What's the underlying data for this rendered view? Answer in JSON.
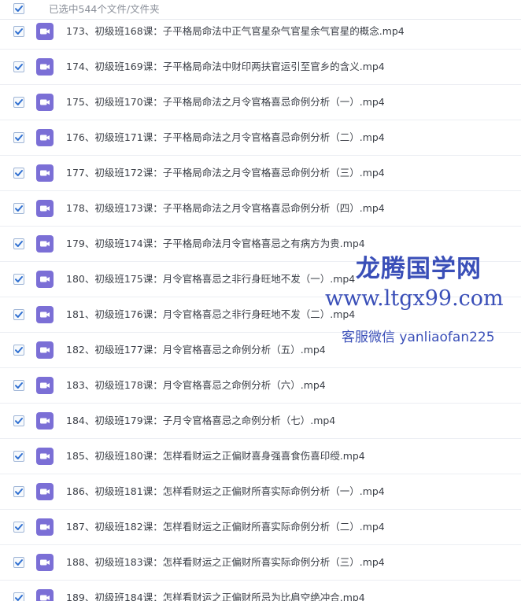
{
  "header": {
    "selected_text": "已选中544个文件/文件夹",
    "checked": true
  },
  "files": [
    {
      "name": "173、初级班168课：子平格局命法中正气官星杂气官星余气官星的概念.mp4",
      "checked": true,
      "icon": "video-file-icon"
    },
    {
      "name": "174、初级班169课：子平格局命法中财印两扶官运引至官乡的含义.mp4",
      "checked": true,
      "icon": "video-file-icon"
    },
    {
      "name": "175、初级班170课：子平格局命法之月令官格喜忌命例分析（一）.mp4",
      "checked": true,
      "icon": "video-file-icon"
    },
    {
      "name": "176、初级班171课：子平格局命法之月令官格喜忌命例分析（二）.mp4",
      "checked": true,
      "icon": "video-file-icon"
    },
    {
      "name": "177、初级班172课：子平格局命法之月令官格喜忌命例分析（三）.mp4",
      "checked": true,
      "icon": "video-file-icon"
    },
    {
      "name": "178、初级班173课：子平格局命法之月令官格喜忌命例分析（四）.mp4",
      "checked": true,
      "icon": "video-file-icon"
    },
    {
      "name": "179、初级班174课：子平格局命法月令官格喜忌之有病方为贵.mp4",
      "checked": true,
      "icon": "video-file-icon"
    },
    {
      "name": "180、初级班175课：月令官格喜忌之非行身旺地不发（一）.mp4",
      "checked": true,
      "icon": "video-file-icon"
    },
    {
      "name": "181、初级班176课：月令官格喜忌之非行身旺地不发（二）.mp4",
      "checked": true,
      "icon": "video-file-icon"
    },
    {
      "name": "182、初级班177课：月令官格喜忌之命例分析（五）.mp4",
      "checked": true,
      "icon": "video-file-icon"
    },
    {
      "name": "183、初级班178课：月令官格喜忌之命例分析（六）.mp4",
      "checked": true,
      "icon": "video-file-icon"
    },
    {
      "name": "184、初级班179课：子月令官格喜忌之命例分析（七）.mp4",
      "checked": true,
      "icon": "video-file-icon"
    },
    {
      "name": "185、初级班180课：怎样看财运之正偏财喜身强喜食伤喜印绶.mp4",
      "checked": true,
      "icon": "video-file-icon"
    },
    {
      "name": "186、初级班181课：怎样看财运之正偏财所喜实际命例分析（一）.mp4",
      "checked": true,
      "icon": "video-file-icon"
    },
    {
      "name": "187、初级班182课：怎样看财运之正偏财所喜实际命例分析（二）.mp4",
      "checked": true,
      "icon": "video-file-icon"
    },
    {
      "name": "188、初级班183课：怎样看财运之正偏财所喜实际命例分析（三）.mp4",
      "checked": true,
      "icon": "video-file-icon"
    },
    {
      "name": "189、初级班184课：怎样看财运之正偏财所忌为比肩空绝冲合.mp4",
      "checked": true,
      "icon": "video-file-icon"
    }
  ],
  "watermark": {
    "title": "龙腾国学网",
    "url": "www.ltgx99.com",
    "contact": "客服微信 yanliaofan225"
  },
  "colors": {
    "checkbox_check": "#2f6fd1",
    "file_icon_bg": "#7b6fd6",
    "watermark": "#3a4fb8",
    "text": "#3b3f47",
    "muted_text": "#8a8f99"
  }
}
